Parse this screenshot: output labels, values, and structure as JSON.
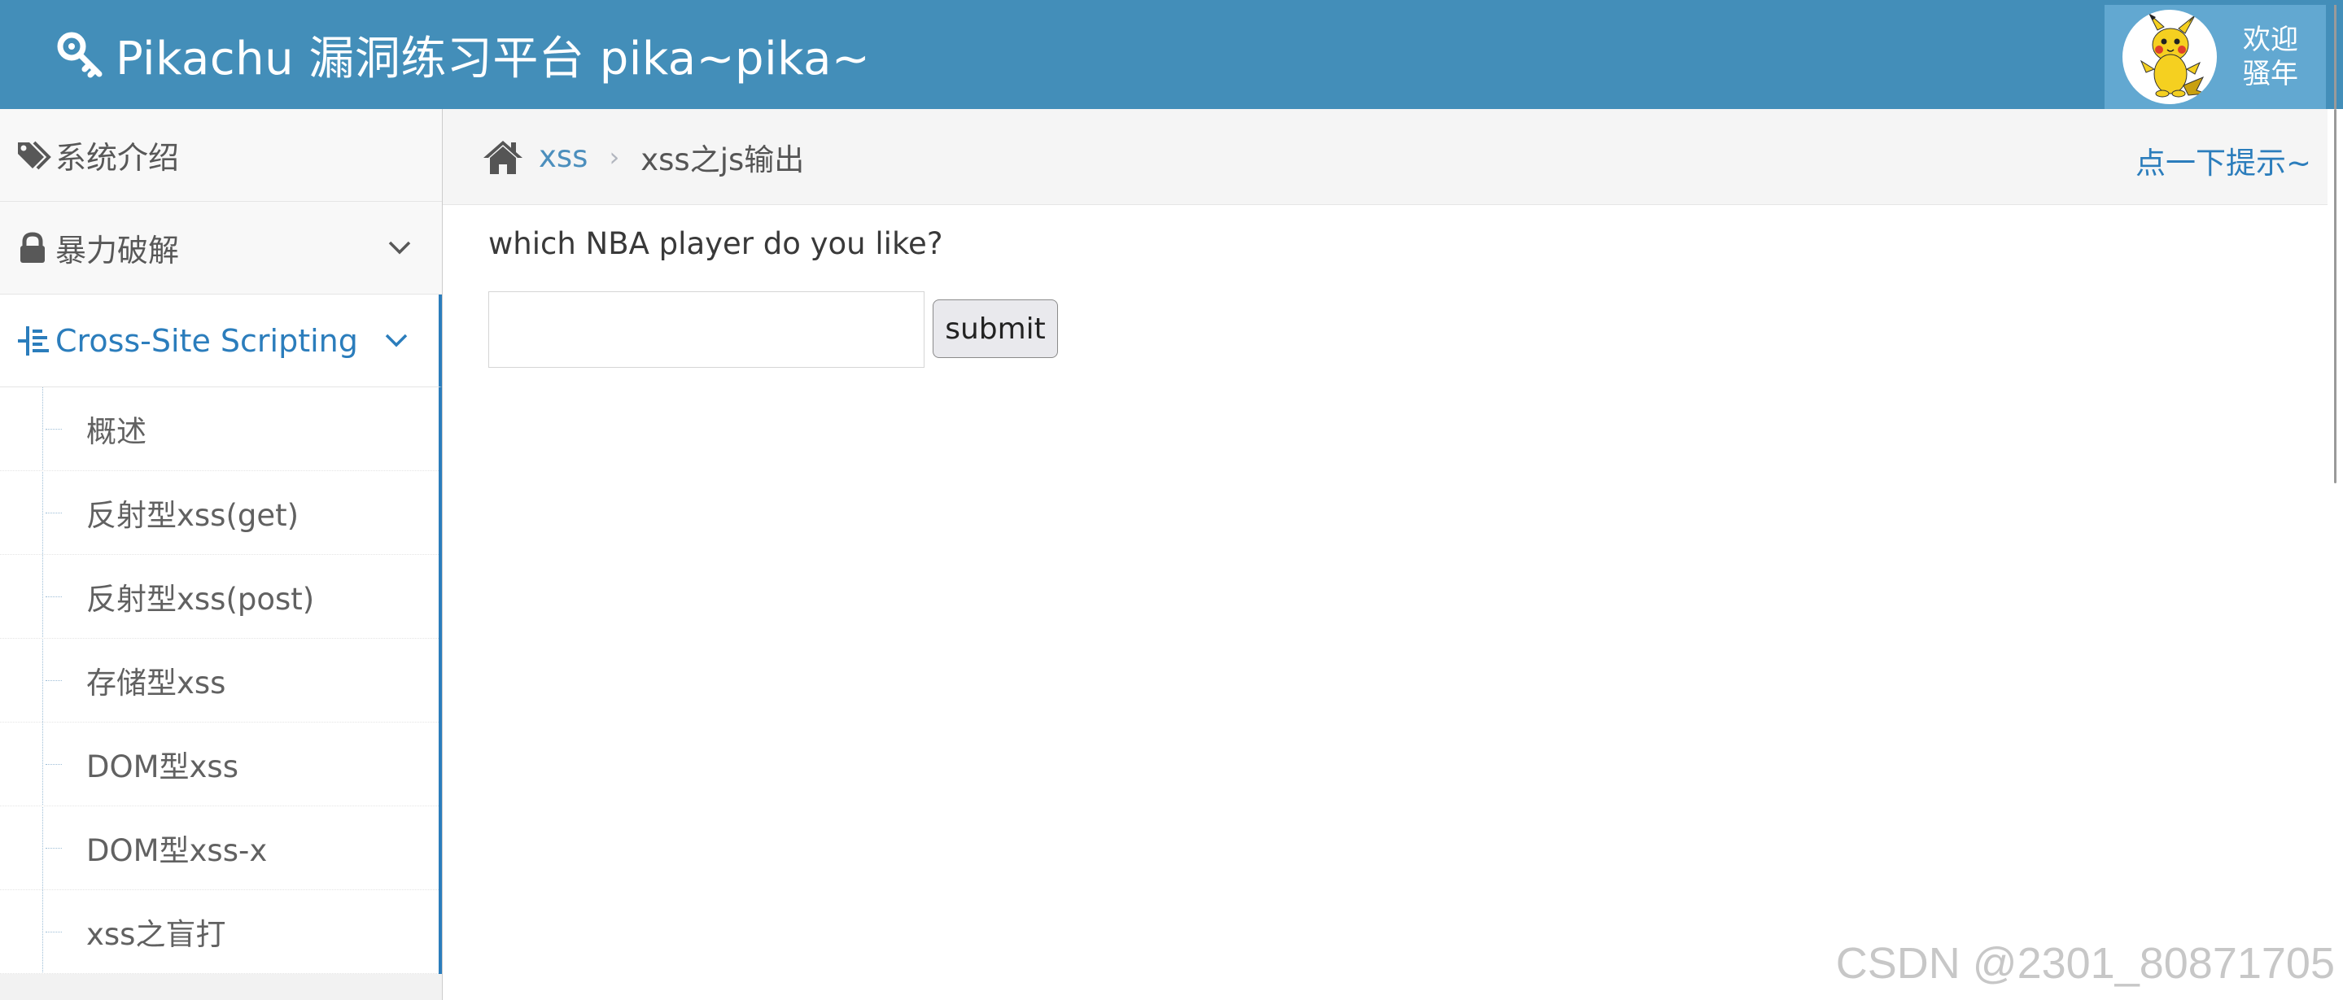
{
  "header": {
    "title": "Pikachu 漏洞练习平台 pika~pika~",
    "welcome_line1": "欢迎",
    "welcome_line2": "骚年"
  },
  "sidebar": {
    "items": [
      {
        "label": "系统介绍",
        "icon": "tags-icon"
      },
      {
        "label": "暴力破解",
        "icon": "lock-icon"
      },
      {
        "label": "Cross-Site Scripting",
        "icon": "list-tree-icon",
        "active": true
      }
    ],
    "submenu": [
      {
        "label": "概述"
      },
      {
        "label": "反射型xss(get)"
      },
      {
        "label": "反射型xss(post)"
      },
      {
        "label": "存储型xss"
      },
      {
        "label": "DOM型xss"
      },
      {
        "label": "DOM型xss-x"
      },
      {
        "label": "xss之盲打"
      }
    ]
  },
  "breadcrumbs": {
    "link": "xss",
    "separator": "›",
    "current": "xss之js输出",
    "hint": "点一下提示~"
  },
  "main": {
    "question": "which NBA player do you like?",
    "input_value": "",
    "submit_label": "submit"
  },
  "watermark": "CSDN @2301_80871705",
  "colors": {
    "header_bg": "#438eb9",
    "user_bg": "#62a8d1",
    "accent": "#2b7dbc",
    "link": "#4c8fbd"
  }
}
